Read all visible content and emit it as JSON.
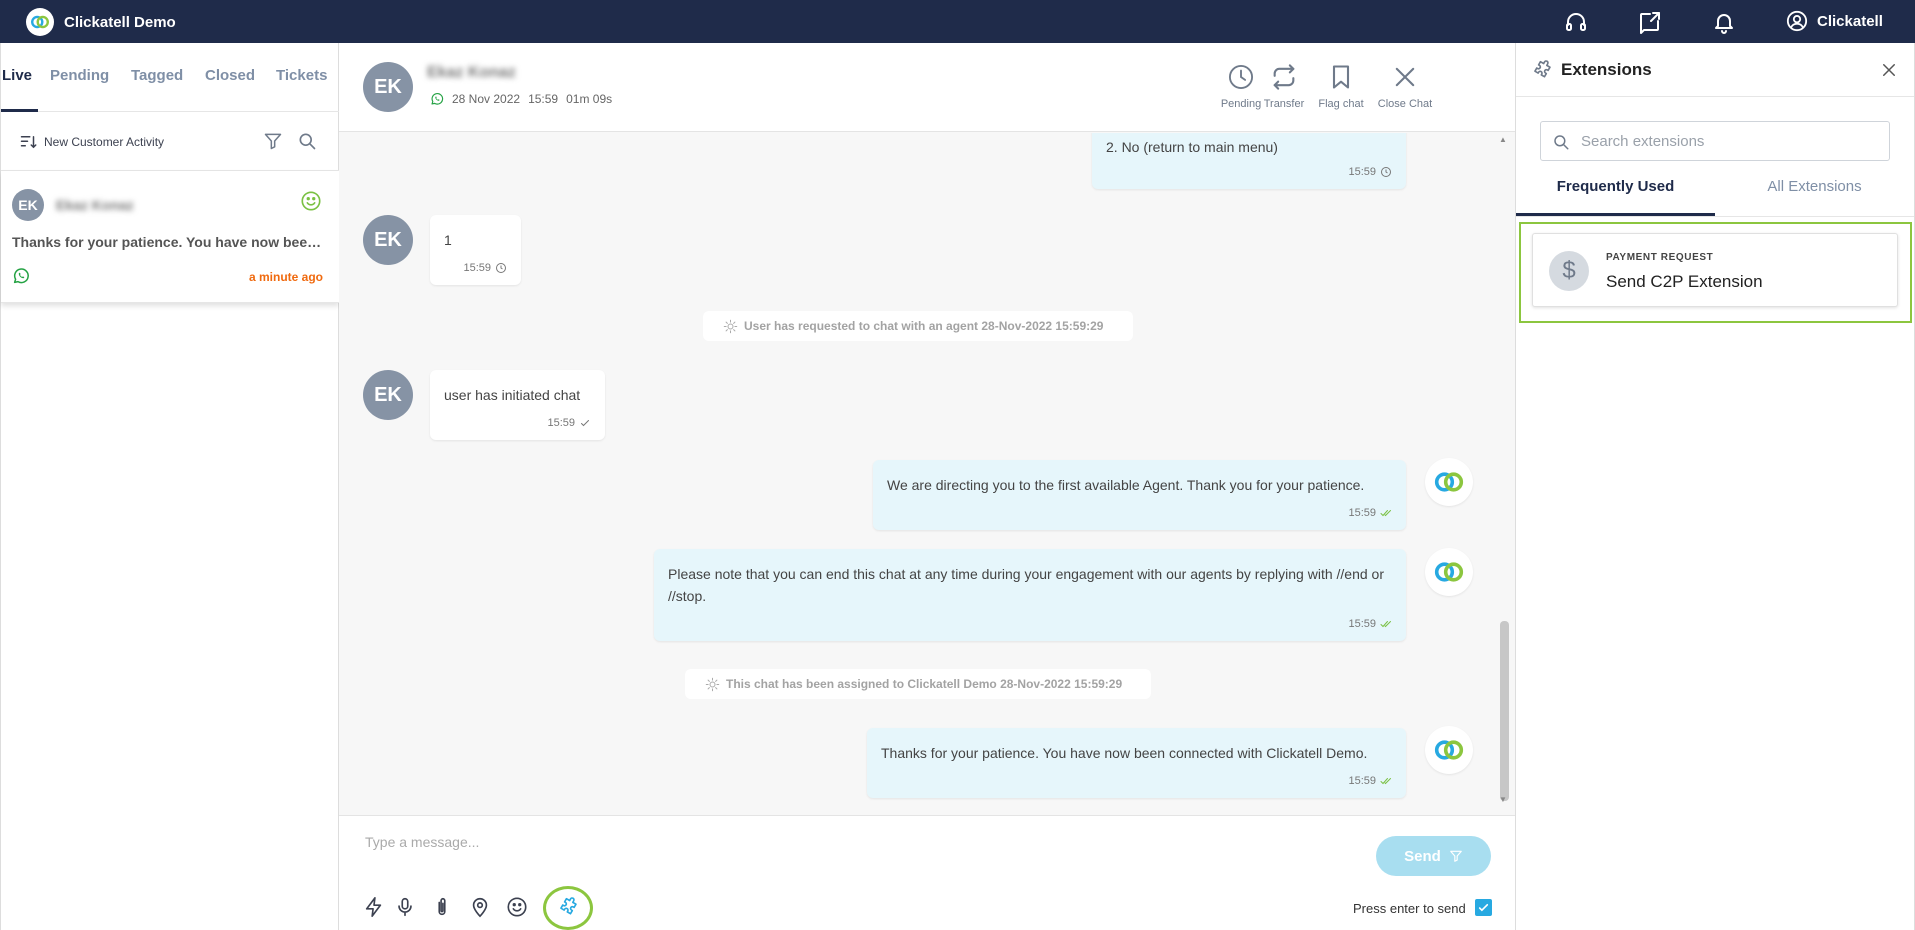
{
  "app": {
    "name": "Clickatell Demo",
    "account_name": "Clickatell"
  },
  "left_panel": {
    "tabs": [
      {
        "label": "Live",
        "active": true
      },
      {
        "label": "Pending"
      },
      {
        "label": "Tagged"
      },
      {
        "label": "Closed"
      },
      {
        "label": "Tickets"
      }
    ],
    "sort_label": "New Customer Activity",
    "conversation": {
      "initials": "EK",
      "name": "Ekaz Konaz",
      "preview": "Thanks for your patience. You have now been connected with Clickatell Demo.",
      "time": "a minute ago"
    }
  },
  "chat": {
    "contact": {
      "initials": "EK",
      "name": "Ekaz Konaz",
      "date": "28 Nov 2022",
      "time": "15:59",
      "duration": "01m 09s"
    },
    "actions": [
      {
        "label": "Pending",
        "icon": "clock-icon"
      },
      {
        "label": "Transfer",
        "icon": "transfer-icon"
      },
      {
        "label": "Flag chat",
        "icon": "bookmark-icon"
      },
      {
        "label": "Close Chat",
        "icon": "close-icon"
      }
    ],
    "messages": [
      {
        "type": "out",
        "text": "2. No (return to main menu)",
        "time": "15:59",
        "status": "clock"
      },
      {
        "type": "in",
        "initials": "EK",
        "text": "1",
        "time": "15:59",
        "status": "clock"
      },
      {
        "type": "system",
        "text": "User has requested to chat with an agent 28-Nov-2022 15:59:29"
      },
      {
        "type": "in",
        "initials": "EK",
        "text": "user has initiated chat",
        "time": "15:59",
        "status": "tick"
      },
      {
        "type": "out",
        "text": "We are directing you to the first available Agent. Thank you for your patience.",
        "time": "15:59",
        "status": "tick"
      },
      {
        "type": "out",
        "text": "Please note that you can end this chat at any time during your engagement with our agents by replying with //end or //stop.",
        "time": "15:59",
        "status": "tick"
      },
      {
        "type": "system",
        "text": "This chat has been assigned to Clickatell Demo 28-Nov-2022 15:59:29"
      },
      {
        "type": "out",
        "text": "Thanks for your patience. You have now been connected with Clickatell Demo.",
        "time": "15:59",
        "status": "tick"
      }
    ],
    "composer": {
      "placeholder": "Type a message...",
      "send_label": "Send",
      "enter_to_send_label": "Press enter to send",
      "enter_to_send_checked": true,
      "tools": [
        "lightning-icon",
        "microphone-icon",
        "paperclip-icon",
        "location-pin-icon",
        "emoji-icon",
        "puzzle-extension-icon"
      ]
    }
  },
  "extensions": {
    "title": "Extensions",
    "search_placeholder": "Search extensions",
    "tabs": [
      {
        "label": "Frequently Used",
        "active": true
      },
      {
        "label": "All Extensions"
      }
    ],
    "items": [
      {
        "category": "PAYMENT REQUEST",
        "name": "Send C2P Extension",
        "icon": "dollar-icon"
      }
    ]
  },
  "colors": {
    "topbar": "#1f2b4a",
    "accent_green": "#8cc63f",
    "outgoing_bubble": "#e6f6fb",
    "send_button": "#a8def0",
    "time_orange": "#f06a0f"
  }
}
